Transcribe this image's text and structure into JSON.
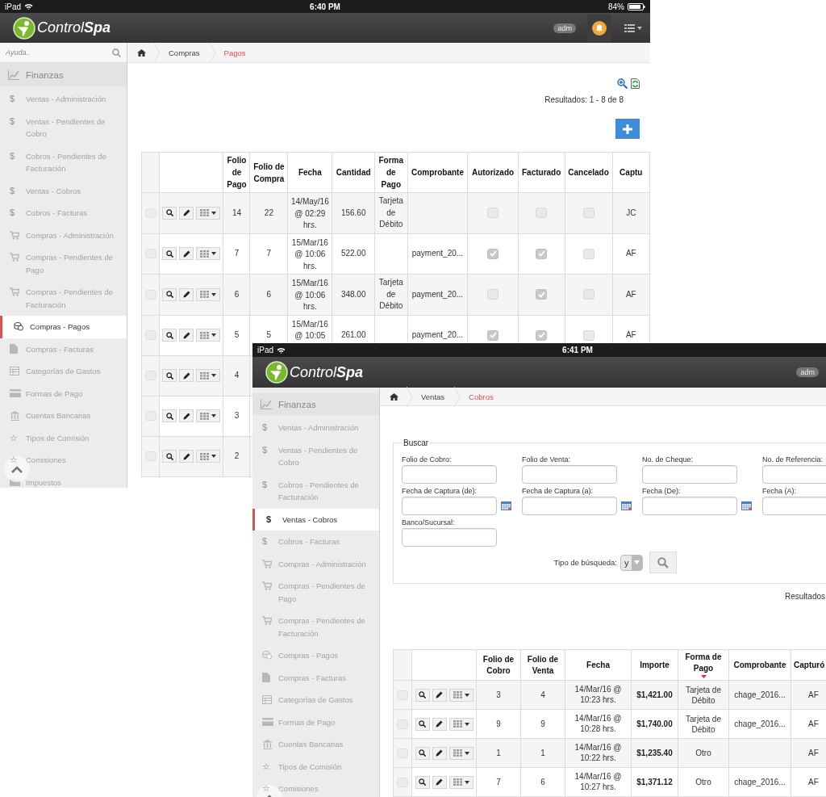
{
  "screens": [
    {
      "status_bar": {
        "device": "iPad",
        "time": "6:40 PM",
        "battery": "84%"
      },
      "header": {
        "logo": "Control**Spa**",
        "badge": "adm",
        "buttons": [
          {
            "kind": "notifications"
          },
          {
            "kind": "menu"
          }
        ]
      },
      "sidebar": {
        "search": {
          "placeholder": "Ayuda.."
        },
        "section": "Finanzas",
        "items": [
          {
            "label": "Ventas - Administración",
            "kind": "dollar",
            "glyph": "$",
            "selected": false
          },
          {
            "label": "Ventas - Pendientes de Cobro",
            "kind": "dollar",
            "glyph": "$",
            "selected": false
          },
          {
            "label": "Cobros - Pendientes de Facturación",
            "kind": "dollar",
            "glyph": "$",
            "selected": false
          },
          {
            "label": "Ventas - Cobros",
            "kind": "dollar",
            "glyph": "$",
            "selected": false
          },
          {
            "label": "Cobros - Facturas",
            "kind": "dollar",
            "glyph": "$",
            "selected": false
          },
          {
            "label": "Compras - Administración",
            "kind": "cart",
            "selected": false
          },
          {
            "label": "Compras - Pendientes de Pago",
            "kind": "cart",
            "selected": false
          },
          {
            "label": "Compras - Pendientes de Facturación",
            "kind": "cart",
            "selected": false
          },
          {
            "label": "Compras - Pagos",
            "kind": "coins",
            "selected": true
          },
          {
            "label": "Compras - Facturas",
            "kind": "file",
            "selected": false
          },
          {
            "label": "Categorías de Gastos",
            "kind": "table",
            "selected": false
          },
          {
            "label": "Formas de Pago",
            "kind": "card",
            "selected": false
          },
          {
            "label": "Cuentas Bancarias",
            "kind": "bank",
            "selected": false
          },
          {
            "label": "Tipos de Comisión",
            "kind": "star",
            "glyph": "☆",
            "selected": false
          },
          {
            "label": "Comisiones",
            "kind": "star",
            "glyph": "☆",
            "selected": false
          },
          {
            "label": "Impuestos",
            "kind": "folder",
            "selected": false
          }
        ]
      },
      "breadcrumb": [
        {
          "label": "Compras",
          "current": false
        },
        {
          "label": "Pagos",
          "current": true
        }
      ],
      "toolbar": {
        "buttons": [
          {
            "kind": "zoom"
          },
          {
            "kind": "export"
          }
        ],
        "add_button": true
      },
      "results": "Resultados: 1 - 8 de 8",
      "table": {
        "columns": [
          {
            "label": "Folio de Pago",
            "kind": "text"
          },
          {
            "label": "Folio de Compra",
            "kind": "text"
          },
          {
            "label": "Fecha",
            "kind": "date"
          },
          {
            "label": "Cantidad",
            "kind": "text"
          },
          {
            "label": "Forma de Pago",
            "kind": "text"
          },
          {
            "label": "Comprobante",
            "kind": "text"
          },
          {
            "label": "Autorizado",
            "kind": "check"
          },
          {
            "label": "Facturado",
            "kind": "check"
          },
          {
            "label": "Cancelado",
            "kind": "check"
          },
          {
            "label": "Captu",
            "kind": "text"
          }
        ],
        "rows": [
          {
            "selected": false,
            "cells": [
              "14",
              "22",
              "14/May/16 @ 02:29 hrs.",
              "156.60",
              "Tarjeta de Débito",
              null,
              false,
              false,
              false,
              "JC"
            ]
          },
          {
            "selected": false,
            "cells": [
              "7",
              "7",
              "15/Mar/16 @ 10:06 hrs.",
              "522.00",
              null,
              "payment_20...",
              true,
              true,
              false,
              "AF"
            ]
          },
          {
            "selected": false,
            "cells": [
              "6",
              "6",
              "15/Mar/16 @ 10:06 hrs.",
              "348.00",
              "Tarjeta de Débito",
              "payment_20...",
              false,
              true,
              false,
              "AF"
            ]
          },
          {
            "selected": false,
            "cells": [
              "5",
              "5",
              "15/Mar/16 @ 10:05",
              "261.00",
              null,
              "payment_20...",
              true,
              true,
              false,
              "AF"
            ]
          },
          {
            "selected": false,
            "cells": [
              "4"
            ]
          },
          {
            "selected": false,
            "cells": [
              "3"
            ]
          },
          {
            "selected": false,
            "cells": [
              "2"
            ]
          }
        ]
      }
    },
    {
      "status_bar": {
        "device": "iPad",
        "time": "6:41 PM"
      },
      "header": {
        "logo": "Control**Spa**",
        "badge": "adm"
      },
      "sidebar": {
        "section": "Finanzas",
        "items": [
          {
            "label": "Ventas - Administración",
            "kind": "dollar",
            "glyph": "$",
            "selected": false
          },
          {
            "label": "Ventas - Pendientes de Cobro",
            "kind": "dollar",
            "glyph": "$",
            "selected": false
          },
          {
            "label": "Cobros - Pendientes de Facturación",
            "kind": "dollar",
            "glyph": "$",
            "selected": false
          },
          {
            "label": "Ventas - Cobros",
            "kind": "dollar",
            "glyph": "$",
            "selected": true
          },
          {
            "label": "Cobros - Facturas",
            "kind": "dollar",
            "glyph": "$",
            "selected": false
          },
          {
            "label": "Compras - Administración",
            "kind": "cart",
            "selected": false
          },
          {
            "label": "Compras - Pendientes de Pago",
            "kind": "cart",
            "selected": false
          },
          {
            "label": "Compras - Pendientes de Facturación",
            "kind": "cart",
            "selected": false
          },
          {
            "label": "Compras - Pagos",
            "kind": "coins",
            "selected": false
          },
          {
            "label": "Compras - Facturas",
            "kind": "file",
            "selected": false
          },
          {
            "label": "Categorías de Gastos",
            "kind": "table",
            "selected": false
          },
          {
            "label": "Formas de Pago",
            "kind": "card",
            "selected": false
          },
          {
            "label": "Cuentas Bancarias",
            "kind": "bank",
            "selected": false
          },
          {
            "label": "Tipos de Comisión",
            "kind": "star",
            "glyph": "☆",
            "selected": false
          },
          {
            "label": "Comisiones",
            "kind": "star",
            "glyph": "☆",
            "selected": false
          }
        ]
      },
      "breadcrumb": [
        {
          "label": "Ventas",
          "current": false
        },
        {
          "label": "Cobros",
          "current": true
        }
      ],
      "search_form": {
        "legend": "Buscar",
        "fields": [
          {
            "label": "Folio de Cobro:",
            "kind": "text"
          },
          {
            "label": "Folio de Venta:",
            "kind": "text"
          },
          {
            "label": "No. de Cheque:",
            "kind": "text"
          },
          {
            "label": "No. de Referencia:",
            "kind": "text"
          },
          {
            "label": "Fecha de Captura (de):",
            "kind": "date"
          },
          {
            "label": "Fecha de Captura (a):",
            "kind": "date"
          },
          {
            "label": "Fecha (De):",
            "kind": "date"
          },
          {
            "label": "Fecha (A):",
            "kind": "text"
          },
          {
            "label": "Banco/Sucursal:",
            "kind": "text"
          }
        ],
        "search_type": {
          "label": "Tipo de búsqueda:",
          "value": "y"
        }
      },
      "results": "Resultados",
      "table": {
        "columns": [
          {
            "label": "Folio de Cobro",
            "kind": "text",
            "sorted": false
          },
          {
            "label": "Folio de Venta",
            "kind": "text",
            "sorted": false
          },
          {
            "label": "Fecha",
            "kind": "date",
            "sorted": false
          },
          {
            "label": "Importe",
            "kind": "amount",
            "sorted": false
          },
          {
            "label": "Forma de Pago",
            "kind": "text",
            "sorted": true
          },
          {
            "label": "Comprobante",
            "kind": "text",
            "sorted": false
          },
          {
            "label": "Capturó",
            "kind": "text",
            "sorted": false
          }
        ],
        "rows": [
          {
            "selected": false,
            "cells": [
              "3",
              "4",
              "14/Mar/16 @ 10:23 hrs.",
              "$1,421.00",
              "Tarjeta de Débito",
              "chage_2016...",
              "AF"
            ]
          },
          {
            "selected": false,
            "cells": [
              "9",
              "9",
              "14/Mar/16 @ 10:28 hrs.",
              "$1,740.00",
              "Tarjeta de Débito",
              "chage_2016...",
              "AF"
            ]
          },
          {
            "selected": false,
            "cells": [
              "1",
              "1",
              "14/Mar/16 @ 10:22 hrs.",
              "$1,235.40",
              "Otro",
              null,
              "AF"
            ]
          },
          {
            "selected": false,
            "cells": [
              "7",
              "6",
              "14/Mar/16 @ 10:27 hrs.",
              "$1,371.12",
              "Otro",
              "chage_2016...",
              "AF"
            ]
          }
        ]
      }
    }
  ]
}
